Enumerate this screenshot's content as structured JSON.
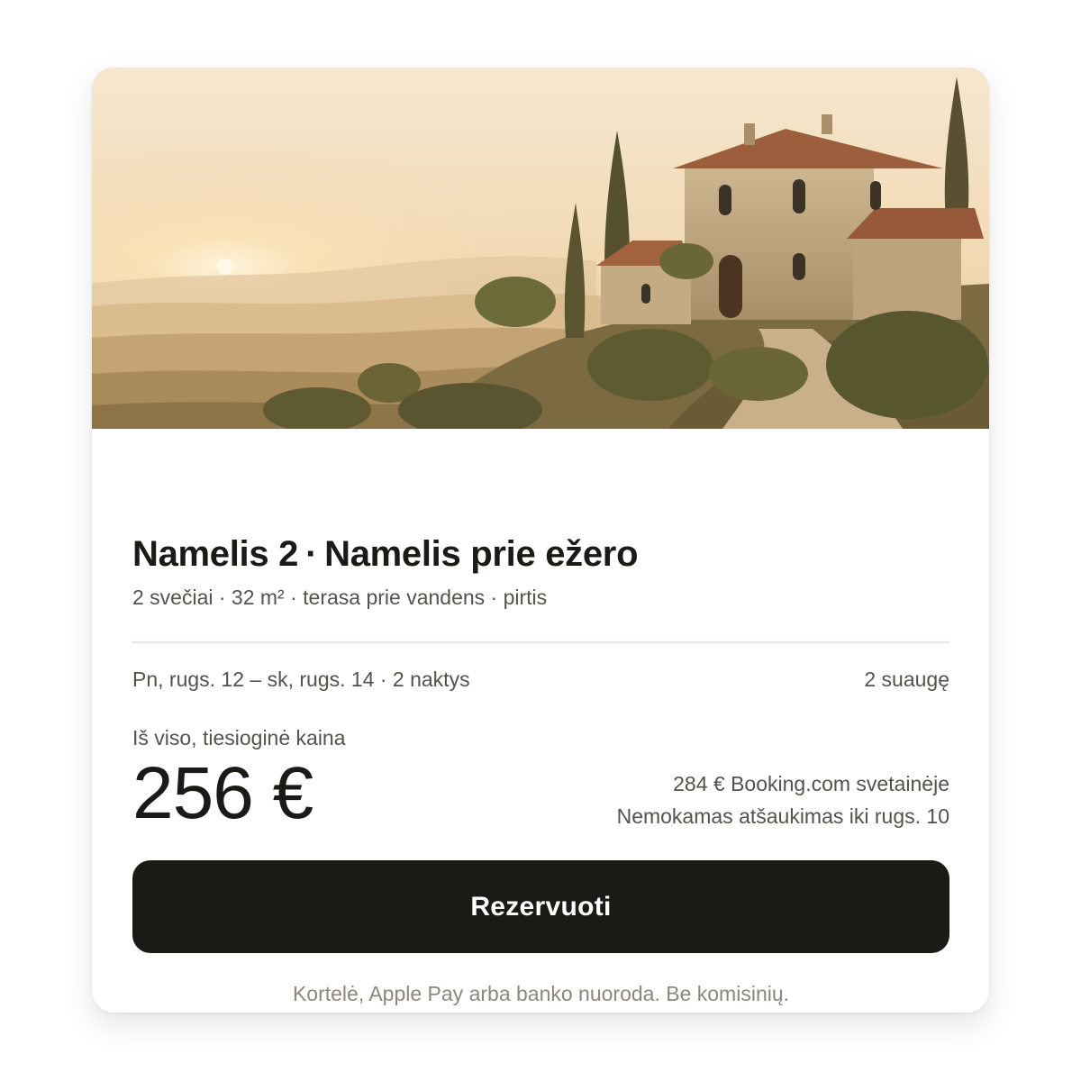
{
  "listing": {
    "image_alt": "stone villa on a hillside at sunset",
    "name_prefix": "Namelis 2",
    "separator": "·",
    "name": "Namelis prie ežero",
    "details": "2 svečiai · 32 m² · terasa prie vandens · pirtis"
  },
  "stay": {
    "dates": "Pn, rugs. 12 – sk, rugs. 14 · 2 naktys",
    "guests": "2 suaugę"
  },
  "pricing": {
    "total_label": "Iš viso, tiesioginė kaina",
    "total": "256 €",
    "comparison": "284 € Booking.com svetainėje",
    "cancellation": "Nemokamas atšaukimas iki rugs. 10"
  },
  "actions": {
    "reserve_label": "Rezervuoti",
    "payment_note": "Kortelė, Apple Pay arba banko nuoroda. Be komisinių."
  },
  "colors": {
    "button": "#1b1a17",
    "text_primary": "#1b1a17",
    "text_secondary": "#55524b",
    "text_muted": "#8b877e",
    "divider": "#e8e4dc"
  }
}
